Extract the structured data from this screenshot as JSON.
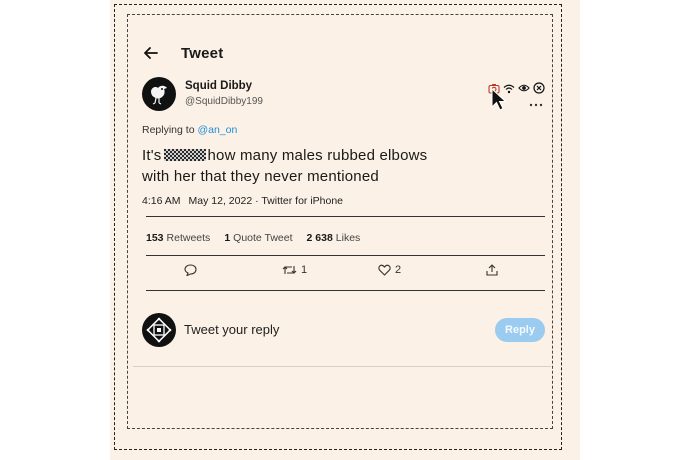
{
  "header": {
    "title": "Tweet"
  },
  "tweet": {
    "author": {
      "name": "Squid Dibby",
      "handle": "@SquidDibby199"
    },
    "reply": {
      "prefix": "Replying to",
      "mention": "@an_on"
    },
    "text": {
      "line1_start": "It's",
      "line1_end": "how many males rubbed elbows",
      "line2": "with her that they never mentioned"
    },
    "meta": {
      "time": "4:16 AM",
      "date": "May 12, 2022",
      "source": "· Twitter for iPhone"
    },
    "stats": {
      "retweets": {
        "count": "153",
        "label": "Retweets"
      },
      "quotes": {
        "count": "1",
        "label": "Quote Tweet"
      },
      "likes": {
        "count": "2 638",
        "label": "Likes"
      }
    },
    "actions": {
      "retweet_count": "1",
      "like_count": "2"
    }
  },
  "status_icons": [
    "camera-icon",
    "wifi-icon",
    "eye-icon",
    "close-circle-icon"
  ],
  "composer": {
    "placeholder": "Tweet your reply",
    "reply_label": "Reply"
  },
  "colors": {
    "background": "#fbf1e6",
    "link": "#1d8fd6",
    "reply_button": "#9bcbef"
  }
}
